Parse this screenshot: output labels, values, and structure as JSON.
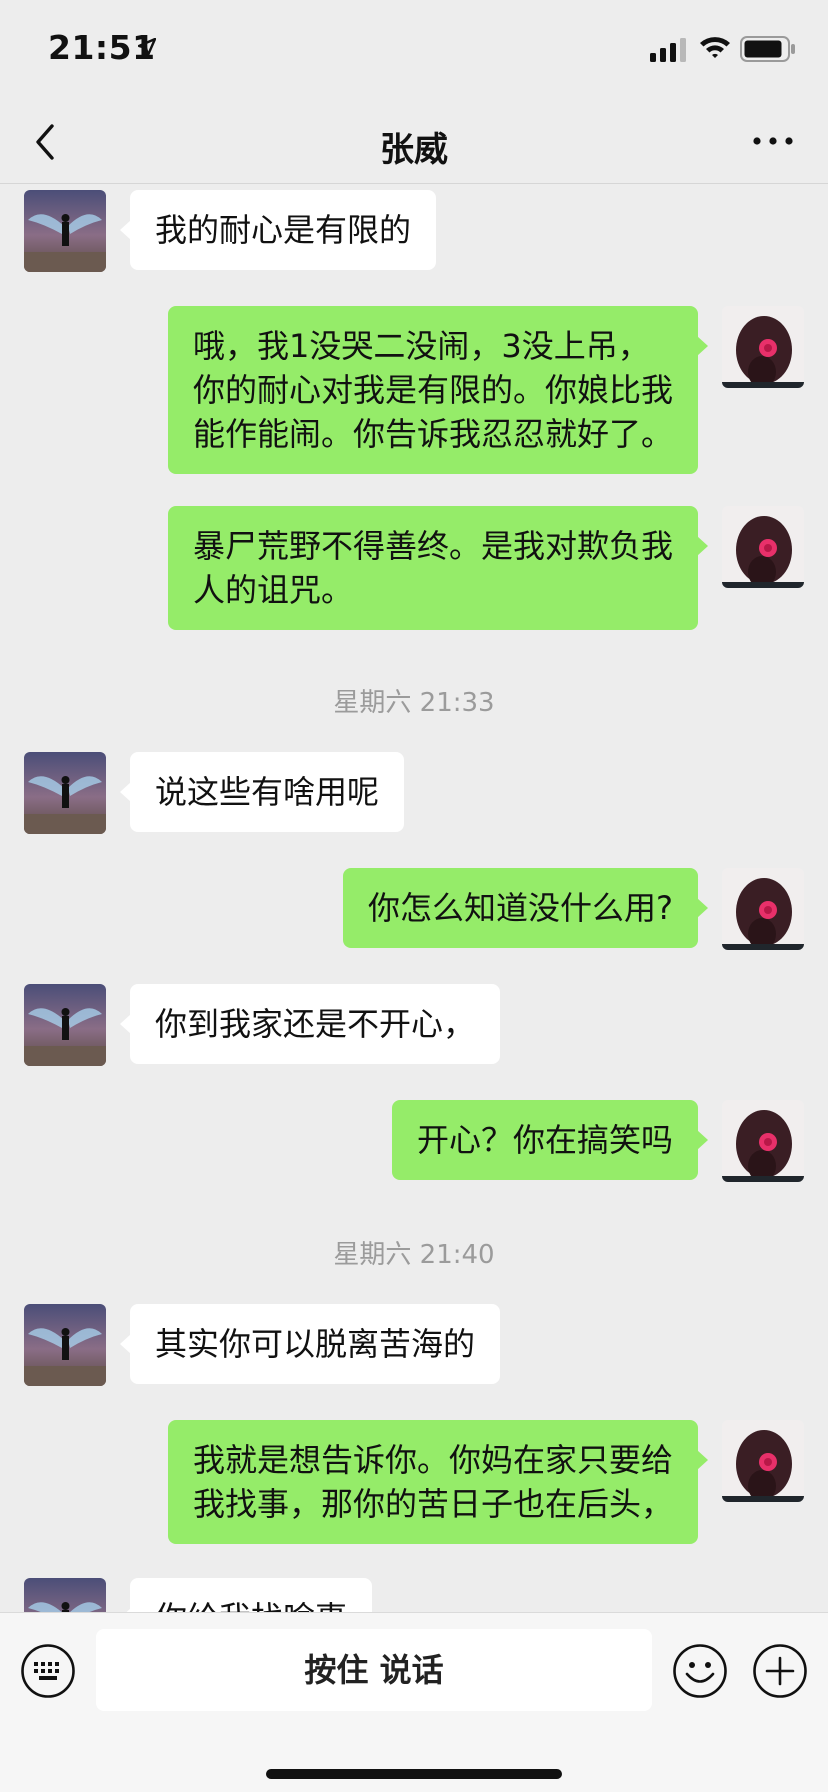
{
  "status_bar": {
    "time": "21:51"
  },
  "nav": {
    "title": "张威"
  },
  "timestamps": [
    "星期六 21:33",
    "星期六 21:40"
  ],
  "messages": [
    {
      "side": "in",
      "text": "我的耐心是有限的"
    },
    {
      "side": "out",
      "text": "哦，我1没哭二没闹，3没上吊，\n你的耐心对我是有限的。你娘比我\n能作能闹。你告诉我忍忍就好了。"
    },
    {
      "side": "out",
      "text": "暴尸荒野不得善终。是我对欺负我\n人的诅咒。"
    },
    {
      "side": "in",
      "text": "说这些有啥用呢"
    },
    {
      "side": "out",
      "text": "你怎么知道没什么用?"
    },
    {
      "side": "in",
      "text": "你到我家还是不开心，"
    },
    {
      "side": "out",
      "text": "开心？你在搞笑吗"
    },
    {
      "side": "in",
      "text": "其实你可以脱离苦海的"
    },
    {
      "side": "out",
      "text": "我就是想告诉你。你妈在家只要给\n我找事，那你的苦日子也在后头，"
    },
    {
      "side": "in",
      "text": "你给我找啥事"
    }
  ],
  "input_bar": {
    "voice_label": "按住 说话"
  },
  "colors": {
    "background": "#ededed",
    "sent_bubble": "#95ec69",
    "received_bubble": "#ffffff"
  },
  "icons": [
    "location-arrow-icon",
    "signal-icon",
    "wifi-icon",
    "battery-icon",
    "back-chevron-icon",
    "more-icon",
    "keyboard-icon",
    "emoji-icon",
    "plus-icon"
  ]
}
